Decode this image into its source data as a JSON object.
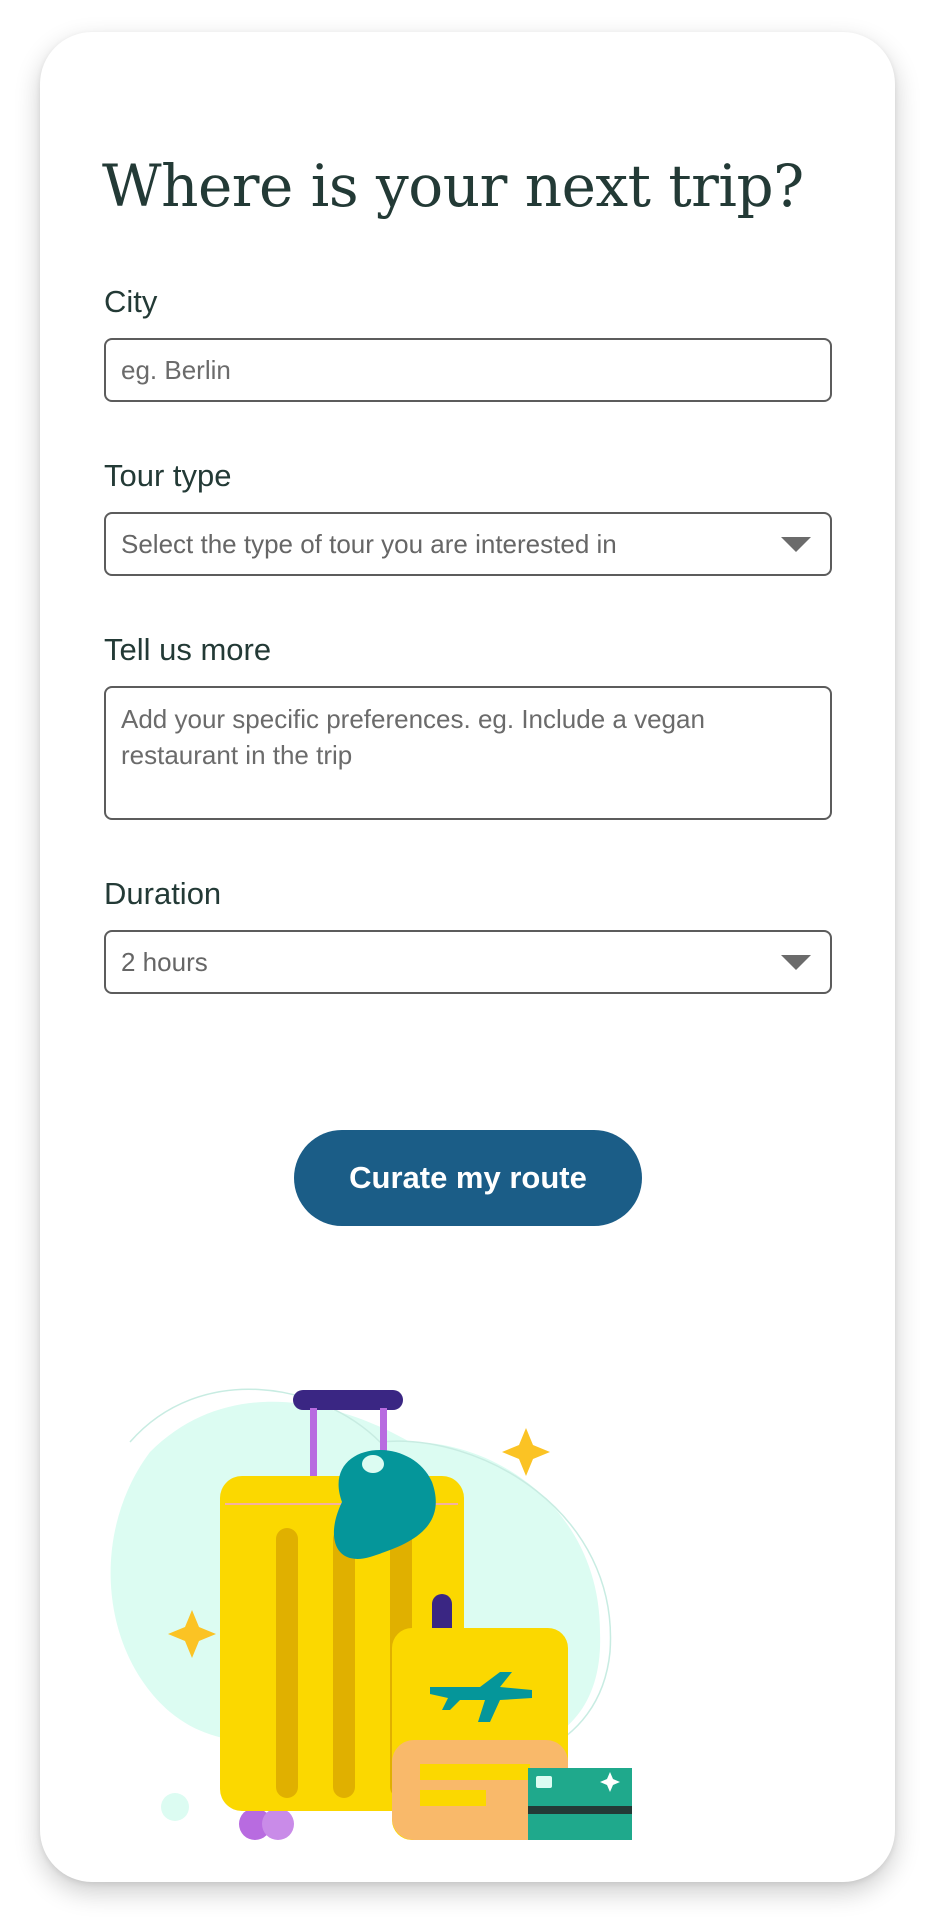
{
  "form": {
    "title": "Where is your next trip?",
    "city": {
      "label": "City",
      "placeholder": "eg. Berlin"
    },
    "tour_type": {
      "label": "Tour type",
      "placeholder": "Select the type of tour you are interested in"
    },
    "more": {
      "label": "Tell us more",
      "placeholder": "Add your specific preferences. eg. Include a vegan restaurant in the trip"
    },
    "duration": {
      "label": "Duration",
      "value": "2 hours"
    },
    "submit_label": "Curate my route"
  },
  "colors": {
    "primary": "#1b5d87",
    "heading": "#233a36",
    "suitcase": "#fbd800",
    "blob": "#dcfcf2",
    "teal": "#05969a"
  },
  "icons": {
    "select_caret": "chevron-down-icon",
    "illustration": "luggage-illustration"
  }
}
